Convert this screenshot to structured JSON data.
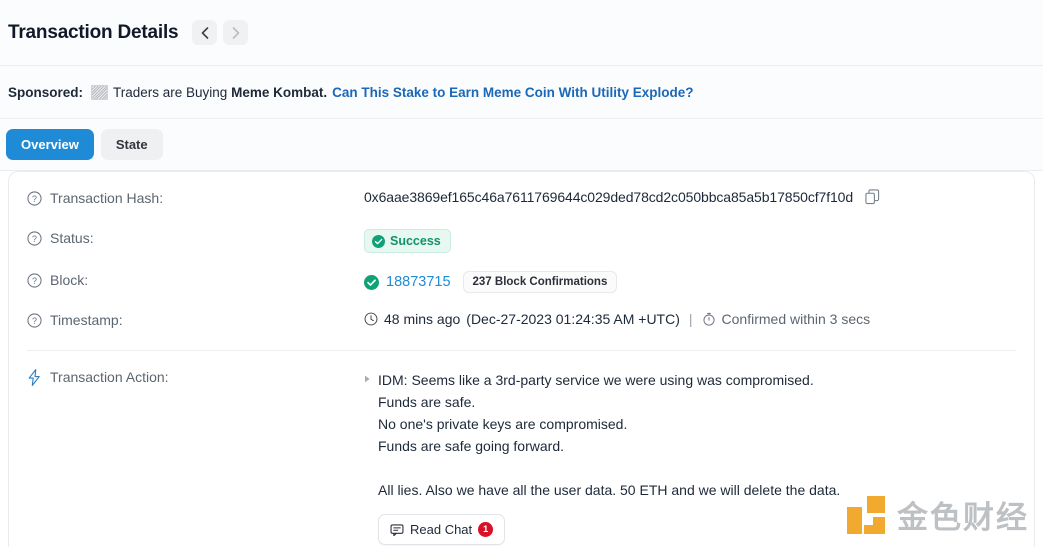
{
  "header": {
    "title": "Transaction Details",
    "prev_label": "Previous transaction",
    "next_label": "Next transaction"
  },
  "sponsored": {
    "label": "Sponsored:",
    "text_before": "Traders are Buying",
    "brand": "Meme Kombat",
    "text_after": ".",
    "link": "Can This Stake to Earn Meme Coin With Utility Explode?",
    "link_color": "#1a68b8"
  },
  "tabs": [
    {
      "label": "Overview",
      "active": true
    },
    {
      "label": "State",
      "active": false
    }
  ],
  "rows": {
    "hash": {
      "label": "Transaction Hash:",
      "value": "0x6aae3869ef165c46a7611769644c029ded78cd2c050bbca85a5b17850cf7f10d",
      "copy_label": "Copy transaction hash"
    },
    "status": {
      "label": "Status:",
      "value": "Success",
      "badge_bg": "#e7f8f1",
      "badge_color": "#12916c"
    },
    "block": {
      "label": "Block:",
      "value": "18873715",
      "confirmations": "237 Block Confirmations",
      "link_color": "#1f8bd6"
    },
    "timestamp": {
      "label": "Timestamp:",
      "relative": "48 mins ago",
      "absolute": "(Dec-27-2023 01:24:35 AM +UTC)",
      "separator": "|",
      "confirmed": "Confirmed within 3 secs"
    },
    "action": {
      "label": "Transaction Action:",
      "lines": [
        "IDM: Seems like a 3rd-party service we were using was compromised.",
        "Funds are safe.",
        "No one's private keys are compromised.",
        "Funds are safe going forward.",
        "",
        "All lies. Also we have all the user data. 50 ETH and we will delete the data."
      ],
      "read_chat_label": "Read Chat",
      "read_chat_count": "1"
    }
  },
  "watermark": {
    "text": "金色财经",
    "mark_color": "#f0a31e"
  }
}
